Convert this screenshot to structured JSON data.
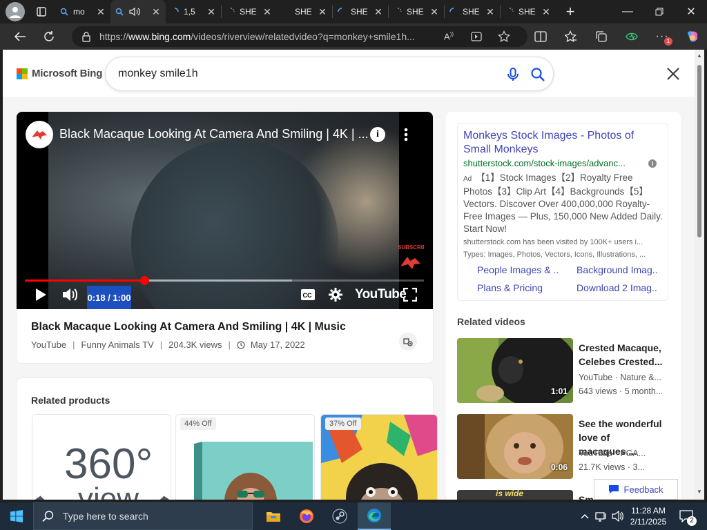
{
  "browser": {
    "tabs": [
      {
        "label": "mo",
        "icon": "bing-search-icon",
        "active": false
      },
      {
        "label": "",
        "icon": "bing-search-icon",
        "audio": true,
        "active": true
      },
      {
        "label": "1,5",
        "icon": "loading-icon",
        "active": false
      },
      {
        "label": "SHE",
        "icon": "loading-icon",
        "active": false
      },
      {
        "label": "SHE",
        "icon": "",
        "active": false
      },
      {
        "label": "SHE",
        "icon": "loading-icon",
        "active": false
      },
      {
        "label": "SHE",
        "icon": "loading-icon",
        "active": false
      },
      {
        "label": "SHE",
        "icon": "loading-icon",
        "active": false
      },
      {
        "label": "SHE",
        "icon": "loading-icon",
        "active": false
      }
    ],
    "url_prefix": "https://",
    "url_domain": "www.bing.com",
    "url_path": "/videos/riverview/relatedvideo?q=monkey+smile1h...",
    "notification_badge": "1"
  },
  "bing": {
    "logo_text": "Microsoft Bing",
    "query": "monkey smile1h"
  },
  "video": {
    "overlay_title": "Black Macaque Looking At Camera And Smiling | 4K | ...",
    "title": "Black Macaque Looking At Camera And Smiling | 4K | Music",
    "source": "YouTube",
    "channel": "Funny Animals TV",
    "views": "204.3K views",
    "date": "May 17, 2022",
    "time": "0:18 / 1:00",
    "progress": 0.3,
    "buffered": 0.67,
    "youtube_label": "YouTube",
    "info_glyph": "i"
  },
  "products": {
    "heading": "Related products",
    "items": [
      {
        "badge": "",
        "image": "360 view",
        "line1": "360°",
        "line2": "view"
      },
      {
        "badge": "44% Off",
        "image": "monkey-canvas"
      },
      {
        "badge": "37% Off",
        "image": "chimp-pop-art"
      }
    ]
  },
  "ad": {
    "title": "Monkeys Stock Images - Photos of Small Monkeys",
    "url": "shutterstock.com/stock-images/advanc...",
    "tag": "Ad",
    "description": "【1】Stock Images【2】Royalty Free Photos【3】Clip Art【4】Backgrounds【5】Vectors. Discover Over 400,000,000 Royalty-Free Images — Plus, 150,000 New Added Daily. Start Now!",
    "visited_note": "shutterstock.com has been visited by 100K+ users i...",
    "types_note": "Types: Images, Photos, Vectors, Icons, Illustrations, ...",
    "links": [
      "People Images & ...",
      "Background Imag...",
      "Plans & Pricing",
      "Download 2 Imag..."
    ]
  },
  "related_videos": {
    "heading": "Related videos",
    "items": [
      {
        "title": "Crested Macaque, Celebes Crested...",
        "source": "YouTube · Nature &...",
        "stats": "643 views · 5 month...",
        "duration": "1:01"
      },
      {
        "title": "See the wonderful love of macaques....",
        "source": "YouTube · PGA...",
        "stats": "21.7K views · 3...",
        "duration": "0:06"
      },
      {
        "title": "Smi",
        "thumb_text": "is wide"
      }
    ]
  },
  "feedback_label": "Feedback",
  "taskbar": {
    "search_placeholder": "Type here to search",
    "time": "11:28 AM",
    "date": "2/11/2025",
    "notifications": "2"
  },
  "colors": {
    "accent_link": "#4045b8",
    "ad_url": "#006d21",
    "progress": "#ff0000",
    "time_highlight": "#1d4fbf"
  }
}
